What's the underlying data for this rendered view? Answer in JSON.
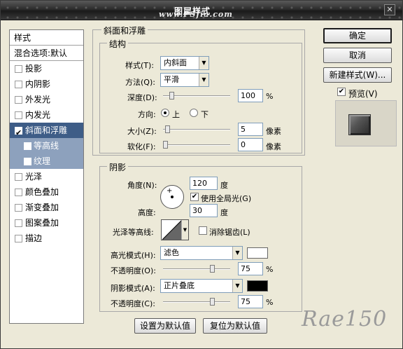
{
  "title": "图层样式",
  "watermark_top": "www.PSfia.com",
  "left": {
    "header": "样式",
    "blend_default": "混合选项:默认",
    "items": [
      {
        "label": "投影",
        "checked": false
      },
      {
        "label": "内阴影",
        "checked": false
      },
      {
        "label": "外发光",
        "checked": false
      },
      {
        "label": "内发光",
        "checked": false
      },
      {
        "label": "斜面和浮雕",
        "checked": true,
        "selected": true
      },
      {
        "label": "等高线",
        "checked": false,
        "sub": true
      },
      {
        "label": "纹理",
        "checked": false,
        "sub": true
      },
      {
        "label": "光泽",
        "checked": false
      },
      {
        "label": "颜色叠加",
        "checked": false
      },
      {
        "label": "渐变叠加",
        "checked": false
      },
      {
        "label": "图案叠加",
        "checked": false
      },
      {
        "label": "描边",
        "checked": false
      }
    ]
  },
  "bevel": {
    "section_title": "斜面和浮雕",
    "structure_title": "结构",
    "style_label": "样式(T):",
    "style_value": "内斜面",
    "method_label": "方法(Q):",
    "method_value": "平滑",
    "depth_label": "深度(D):",
    "depth_value": "100",
    "depth_unit": "%",
    "depth_level": 0.1,
    "direction_label": "方向:",
    "dir_up": "上",
    "dir_down": "下",
    "size_label": "大小(Z):",
    "size_value": "5",
    "size_unit": "像素",
    "size_level": 0.03,
    "soften_label": "软化(F):",
    "soften_value": "0",
    "soften_unit": "像素",
    "soften_level": 0.0
  },
  "shading": {
    "title": "阴影",
    "angle_label": "角度(N):",
    "angle_value": "120",
    "angle_unit": "度",
    "global_light": "使用全局光(G)",
    "altitude_label": "高度:",
    "altitude_value": "30",
    "altitude_unit": "度",
    "gloss_label": "光泽等高线:",
    "anti_alias": "消除锯齿(L)",
    "highlight_label": "高光模式(H):",
    "highlight_value": "滤色",
    "highlight_color": "#ffffff",
    "opacity1_label": "不透明度(O):",
    "opacity1_value": "75",
    "opacity1_level": 0.75,
    "shadow_label": "阴影模式(A):",
    "shadow_value": "正片叠底",
    "shadow_color": "#000000",
    "opacity2_label": "不透明度(C):",
    "opacity2_value": "75",
    "opacity2_level": 0.75,
    "percent": "%"
  },
  "bottom": {
    "make_default": "设置为默认值",
    "reset_default": "复位为默认值"
  },
  "right": {
    "ok": "确定",
    "cancel": "取消",
    "new_style": "新建样式(W)...",
    "preview": "预览(V)"
  },
  "signature": "Rae150"
}
